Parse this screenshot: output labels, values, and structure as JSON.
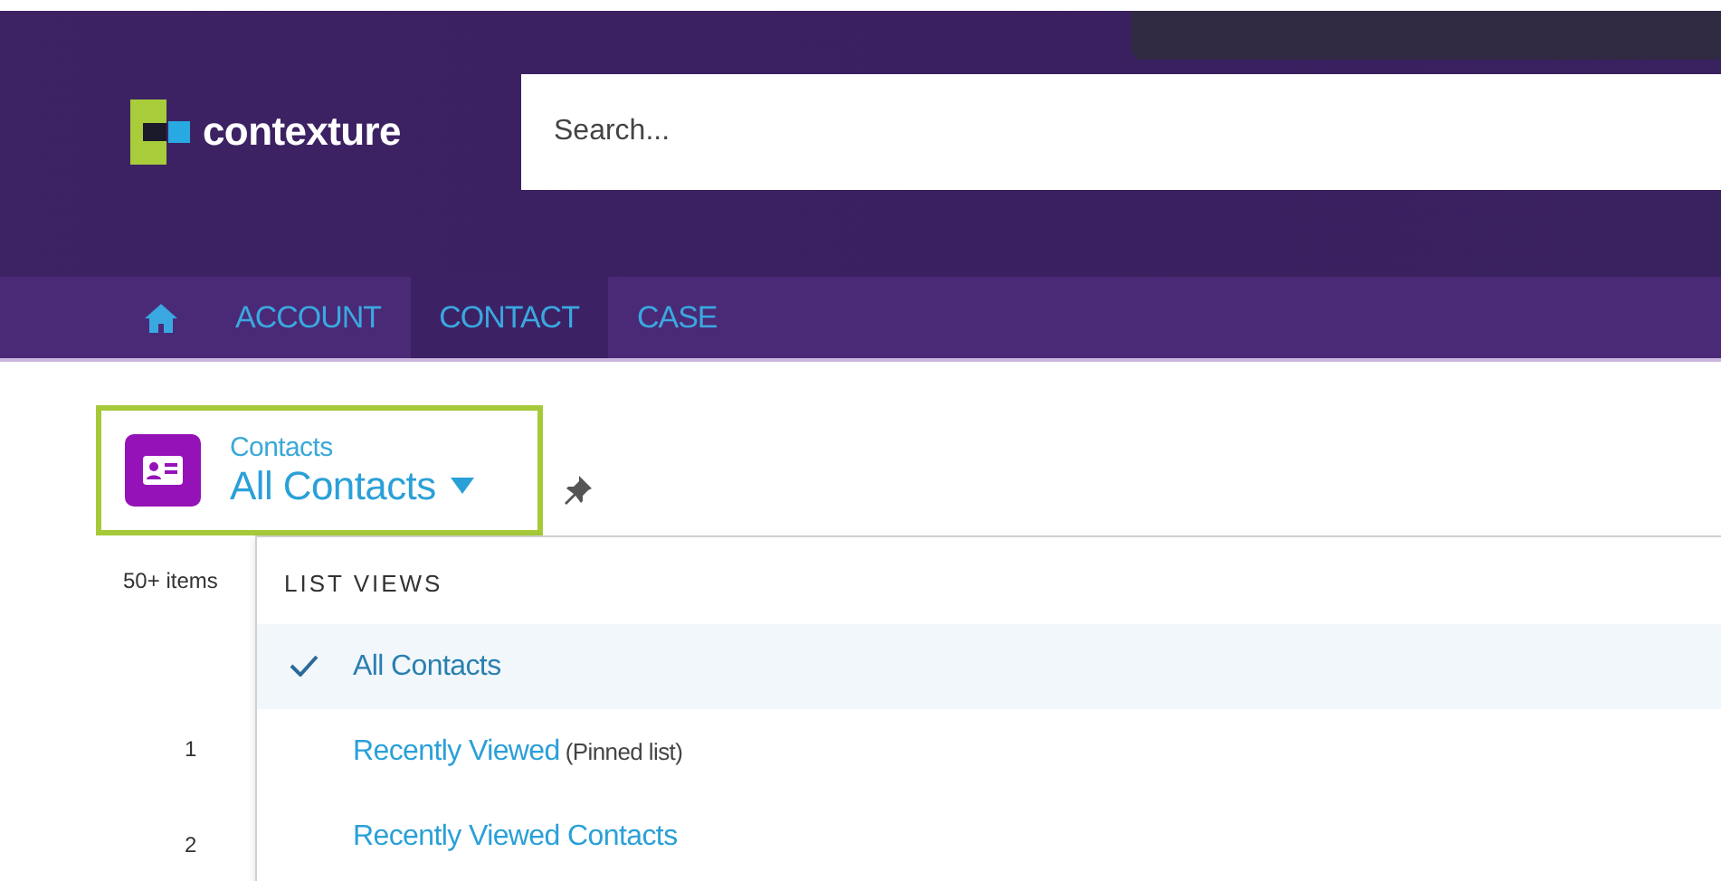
{
  "header": {
    "logo_text": "contexture",
    "search": {
      "placeholder": "Search..."
    }
  },
  "nav": {
    "items": [
      {
        "kind": "home",
        "selected": false
      },
      {
        "kind": "text",
        "label": "ACCOUNT",
        "selected": false
      },
      {
        "kind": "text",
        "label": "CONTACT",
        "selected": true
      },
      {
        "kind": "text",
        "label": "CASE",
        "selected": false
      }
    ]
  },
  "list_header": {
    "object": "Contacts",
    "view": "All Contacts",
    "highlighted": true
  },
  "count": "50+ items",
  "row_numbers": [
    "1",
    "2"
  ],
  "dropdown": {
    "title": "LIST VIEWS",
    "items": [
      {
        "label": "All Contacts",
        "selected": true
      },
      {
        "label": "Recently Viewed",
        "note": "(Pinned list)",
        "selected": false
      },
      {
        "label": "Recently Viewed Contacts",
        "selected": false
      }
    ]
  }
}
